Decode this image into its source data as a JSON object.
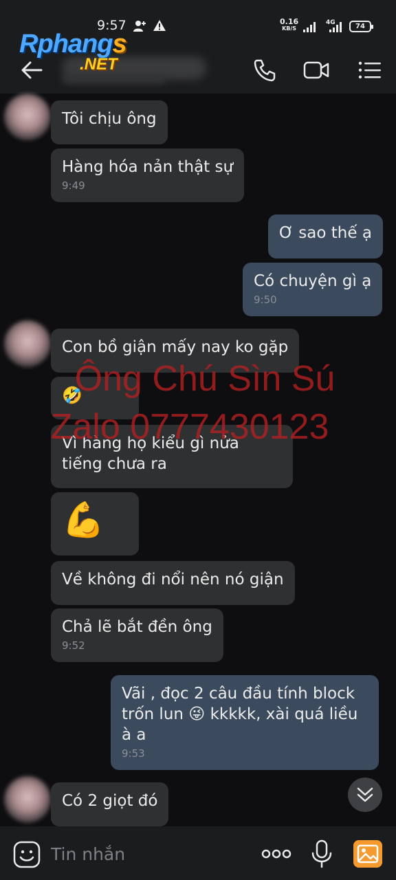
{
  "status_bar": {
    "time": "9:57",
    "net_speed_value": "0.16",
    "net_speed_unit": "KB/S",
    "network_type": "4G",
    "battery": "74"
  },
  "watermark_logo": {
    "part1": "Rphang",
    "part2": "s",
    "part3": ".NET"
  },
  "header": {
    "icons": [
      "back-arrow-icon",
      "phone-icon",
      "video-camera-icon",
      "menu-list-icon"
    ]
  },
  "messages": [
    {
      "side": "received",
      "text": "Tôi chịu ông",
      "time": ""
    },
    {
      "side": "received",
      "text": "Hàng hóa nản thật sự",
      "time": "9:49"
    },
    {
      "side": "sent",
      "text": "Ơ sao thế ạ",
      "time": ""
    },
    {
      "side": "sent",
      "text": "Có chuyện gì ạ",
      "time": "9:50"
    },
    {
      "side": "received",
      "text": "Con bồ giận mấy nay ko gặp",
      "time": ""
    },
    {
      "side": "received",
      "text": "🤣",
      "time": ""
    },
    {
      "side": "received",
      "text": "Vì hàng họ kiểu gì nửa tiếng chưa ra",
      "time": ""
    },
    {
      "side": "received",
      "text": "💪",
      "time": ""
    },
    {
      "side": "received",
      "text": "Về không đi nổi nên nó giận",
      "time": ""
    },
    {
      "side": "received",
      "text": "Chả lẽ bắt đền ông",
      "time": "9:52"
    },
    {
      "side": "sent",
      "text": "Vãi , đọc 2 câu đầu tính block trốn lun 😜 kkkkk, xài quá liều à a",
      "time": "9:53"
    },
    {
      "side": "received",
      "text": "Có 2 giọt đó",
      "time": ""
    }
  ],
  "watermark_text": {
    "line1": "Ông Chú Sìn Sú",
    "line2": "Zalo 0777430123"
  },
  "input_bar": {
    "placeholder": "Tin nhắn"
  },
  "colors": {
    "background": "#0e0e10",
    "bar": "#1b1c1e",
    "received_bubble": "#2f3032",
    "sent_bubble": "#3b4a5c",
    "timestamp": "#8b8f96",
    "watermark": "#b42020"
  }
}
